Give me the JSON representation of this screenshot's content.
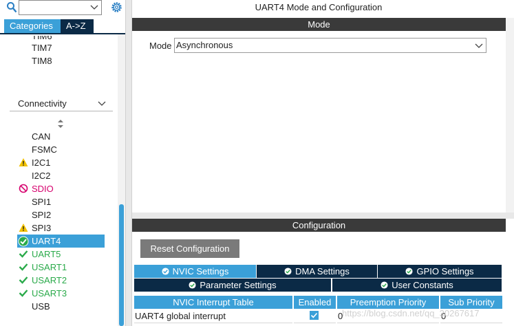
{
  "sidebar": {
    "tabs": {
      "categories": "Categories",
      "az": "A->Z"
    },
    "items_top": [
      "TIM7",
      "TIM8"
    ],
    "category_header": "Connectivity",
    "items": [
      {
        "label": "CAN",
        "status": "none"
      },
      {
        "label": "FSMC",
        "status": "none"
      },
      {
        "label": "I2C1",
        "status": "warning"
      },
      {
        "label": "I2C2",
        "status": "none"
      },
      {
        "label": "SDIO",
        "status": "disabled"
      },
      {
        "label": "SPI1",
        "status": "none"
      },
      {
        "label": "SPI2",
        "status": "none"
      },
      {
        "label": "SPI3",
        "status": "warning"
      },
      {
        "label": "UART4",
        "status": "selected"
      },
      {
        "label": "UART5",
        "status": "ok"
      },
      {
        "label": "USART1",
        "status": "ok"
      },
      {
        "label": "USART2",
        "status": "ok"
      },
      {
        "label": "USART3",
        "status": "ok"
      },
      {
        "label": "USB",
        "status": "none"
      }
    ]
  },
  "main": {
    "title": "UART4 Mode and Configuration",
    "mode_section": "Mode",
    "mode_label": "Mode",
    "mode_value": "Asynchronous",
    "config_section": "Configuration",
    "reset_button": "Reset Configuration",
    "config_tabs": [
      "NVIC Settings",
      "DMA Settings",
      "GPIO Settings",
      "Parameter Settings",
      "User Constants"
    ],
    "table": {
      "headers": [
        "NVIC Interrupt Table",
        "Enabled",
        "Preemption Priority",
        "Sub Priority"
      ],
      "row": {
        "name": "UART4 global interrupt",
        "enabled": true,
        "preemption": "0",
        "sub": "0"
      }
    },
    "watermark": "https://blog.csdn.net/qq_30267617"
  },
  "colors": {
    "accent": "#3ba0d8",
    "dark": "#0b2a46",
    "section_bar": "#3a3a3a",
    "warning": "#f2c200",
    "disabled": "#d6006d",
    "ok": "#2aaa4a"
  }
}
